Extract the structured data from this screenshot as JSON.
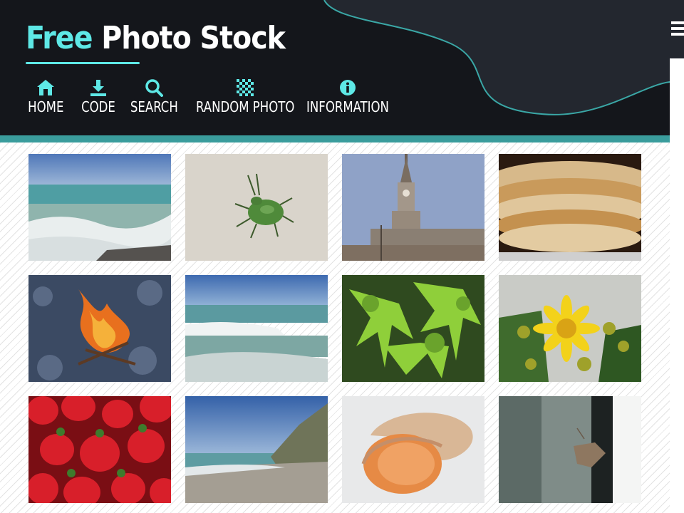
{
  "brand": {
    "free": "Free",
    "rest": "Photo Stock"
  },
  "nav": [
    {
      "label": "HOME",
      "icon": "home-icon"
    },
    {
      "label": "CODE",
      "icon": "download-icon"
    },
    {
      "label": "SEARCH",
      "icon": "search-icon"
    },
    {
      "label": "RANDOM PHOTO",
      "icon": "random-pixels-icon"
    },
    {
      "label": "INFORMATION",
      "icon": "info-icon"
    }
  ],
  "colors": {
    "header_bg": "#14161b",
    "accent": "#5ee8e6",
    "teal_bar": "#3a9c9c"
  },
  "menu_icon": "hamburger-menu-icon",
  "photos": [
    "sea-waves",
    "green-beetle",
    "clock-tower",
    "pancakes",
    "campfire",
    "surf-waves",
    "green-foliage",
    "yellow-flower",
    "strawberries",
    "rocky-coast",
    "seashell",
    "moth-on-glass"
  ]
}
